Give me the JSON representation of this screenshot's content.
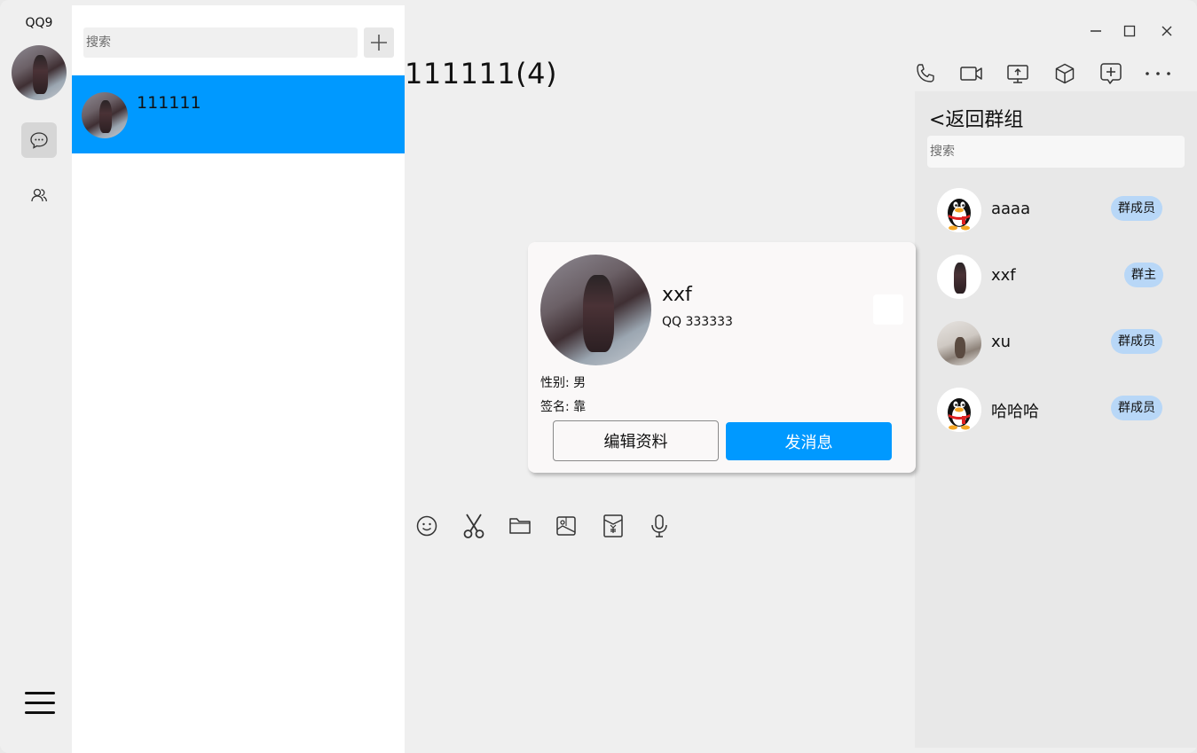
{
  "app": {
    "title": "QQ9"
  },
  "sidebar": {
    "items": [
      {
        "name": "messages",
        "icon": "chat-bubble-icon",
        "active": true
      },
      {
        "name": "contacts",
        "icon": "contacts-icon",
        "active": false
      }
    ],
    "menu_icon": "hamburger-menu-icon"
  },
  "chat_list": {
    "search_placeholder": "搜索",
    "add_icon": "plus-icon",
    "items": [
      {
        "name": "111111",
        "selected": true
      }
    ]
  },
  "chat": {
    "title": "111111(4)",
    "toolbar_icons": [
      "phone-icon",
      "video-icon",
      "screen-share-icon",
      "cube-icon",
      "add-chat-icon",
      "more-icon"
    ],
    "input_tools": [
      "emoji-icon",
      "scissors-icon",
      "folder-icon",
      "image-icon",
      "red-packet-icon",
      "microphone-icon"
    ]
  },
  "window_controls": [
    "minimize-icon",
    "maximize-icon",
    "close-icon"
  ],
  "members_panel": {
    "back_label": "<返回群组",
    "search_placeholder": "搜索",
    "members": [
      {
        "name": "aaaa",
        "role": "群成员",
        "avatar": "penguin"
      },
      {
        "name": "xxf",
        "role": "群主",
        "avatar": "photo"
      },
      {
        "name": "xu",
        "role": "群成员",
        "avatar": "photo-light"
      },
      {
        "name": "哈哈哈",
        "role": "群成员",
        "avatar": "penguin"
      }
    ]
  },
  "profile_card": {
    "name": "xxf",
    "qq": "QQ  333333",
    "gender_line": "性别:  男",
    "signature_line": "签名:  靠",
    "edit_label": "编辑资料",
    "send_label": "发消息"
  },
  "colors": {
    "accent": "#0099ff",
    "badge": "#b8d7f7",
    "panel": "#e8e8e8",
    "background": "#efefef"
  }
}
